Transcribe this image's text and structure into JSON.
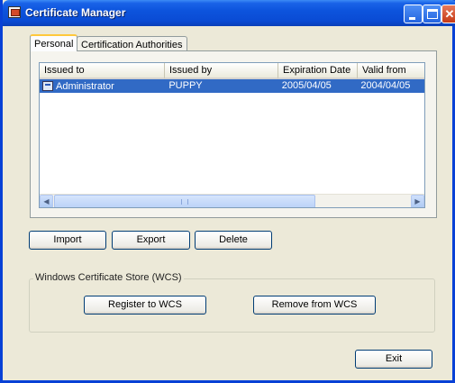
{
  "window": {
    "title": "Certificate Manager"
  },
  "tabs": [
    {
      "label": "Personal",
      "active": true
    },
    {
      "label": "Certification Authorities",
      "active": false
    }
  ],
  "table": {
    "columns": [
      "Issued to",
      "Issued by",
      "Expiration Date",
      "Valid from"
    ],
    "rows": [
      {
        "issued_to": "Administrator",
        "issued_by": "PUPPY",
        "expiration": "2005/04/05",
        "valid_from": "2004/04/05",
        "selected": true
      }
    ]
  },
  "buttons": {
    "import": "Import",
    "export": "Export",
    "delete": "Delete",
    "register": "Register to WCS",
    "remove": "Remove from WCS",
    "exit": "Exit"
  },
  "wcs_group": {
    "title": "Windows Certificate Store (WCS)"
  },
  "colors": {
    "titlebar": "#0a4bd4",
    "selection": "#316ac5",
    "face": "#ece9d8"
  },
  "icons": [
    "app-certificate-icon",
    "minimize-icon",
    "maximize-icon",
    "close-icon",
    "certificate-row-icon",
    "scroll-left-icon",
    "scroll-right-icon"
  ]
}
